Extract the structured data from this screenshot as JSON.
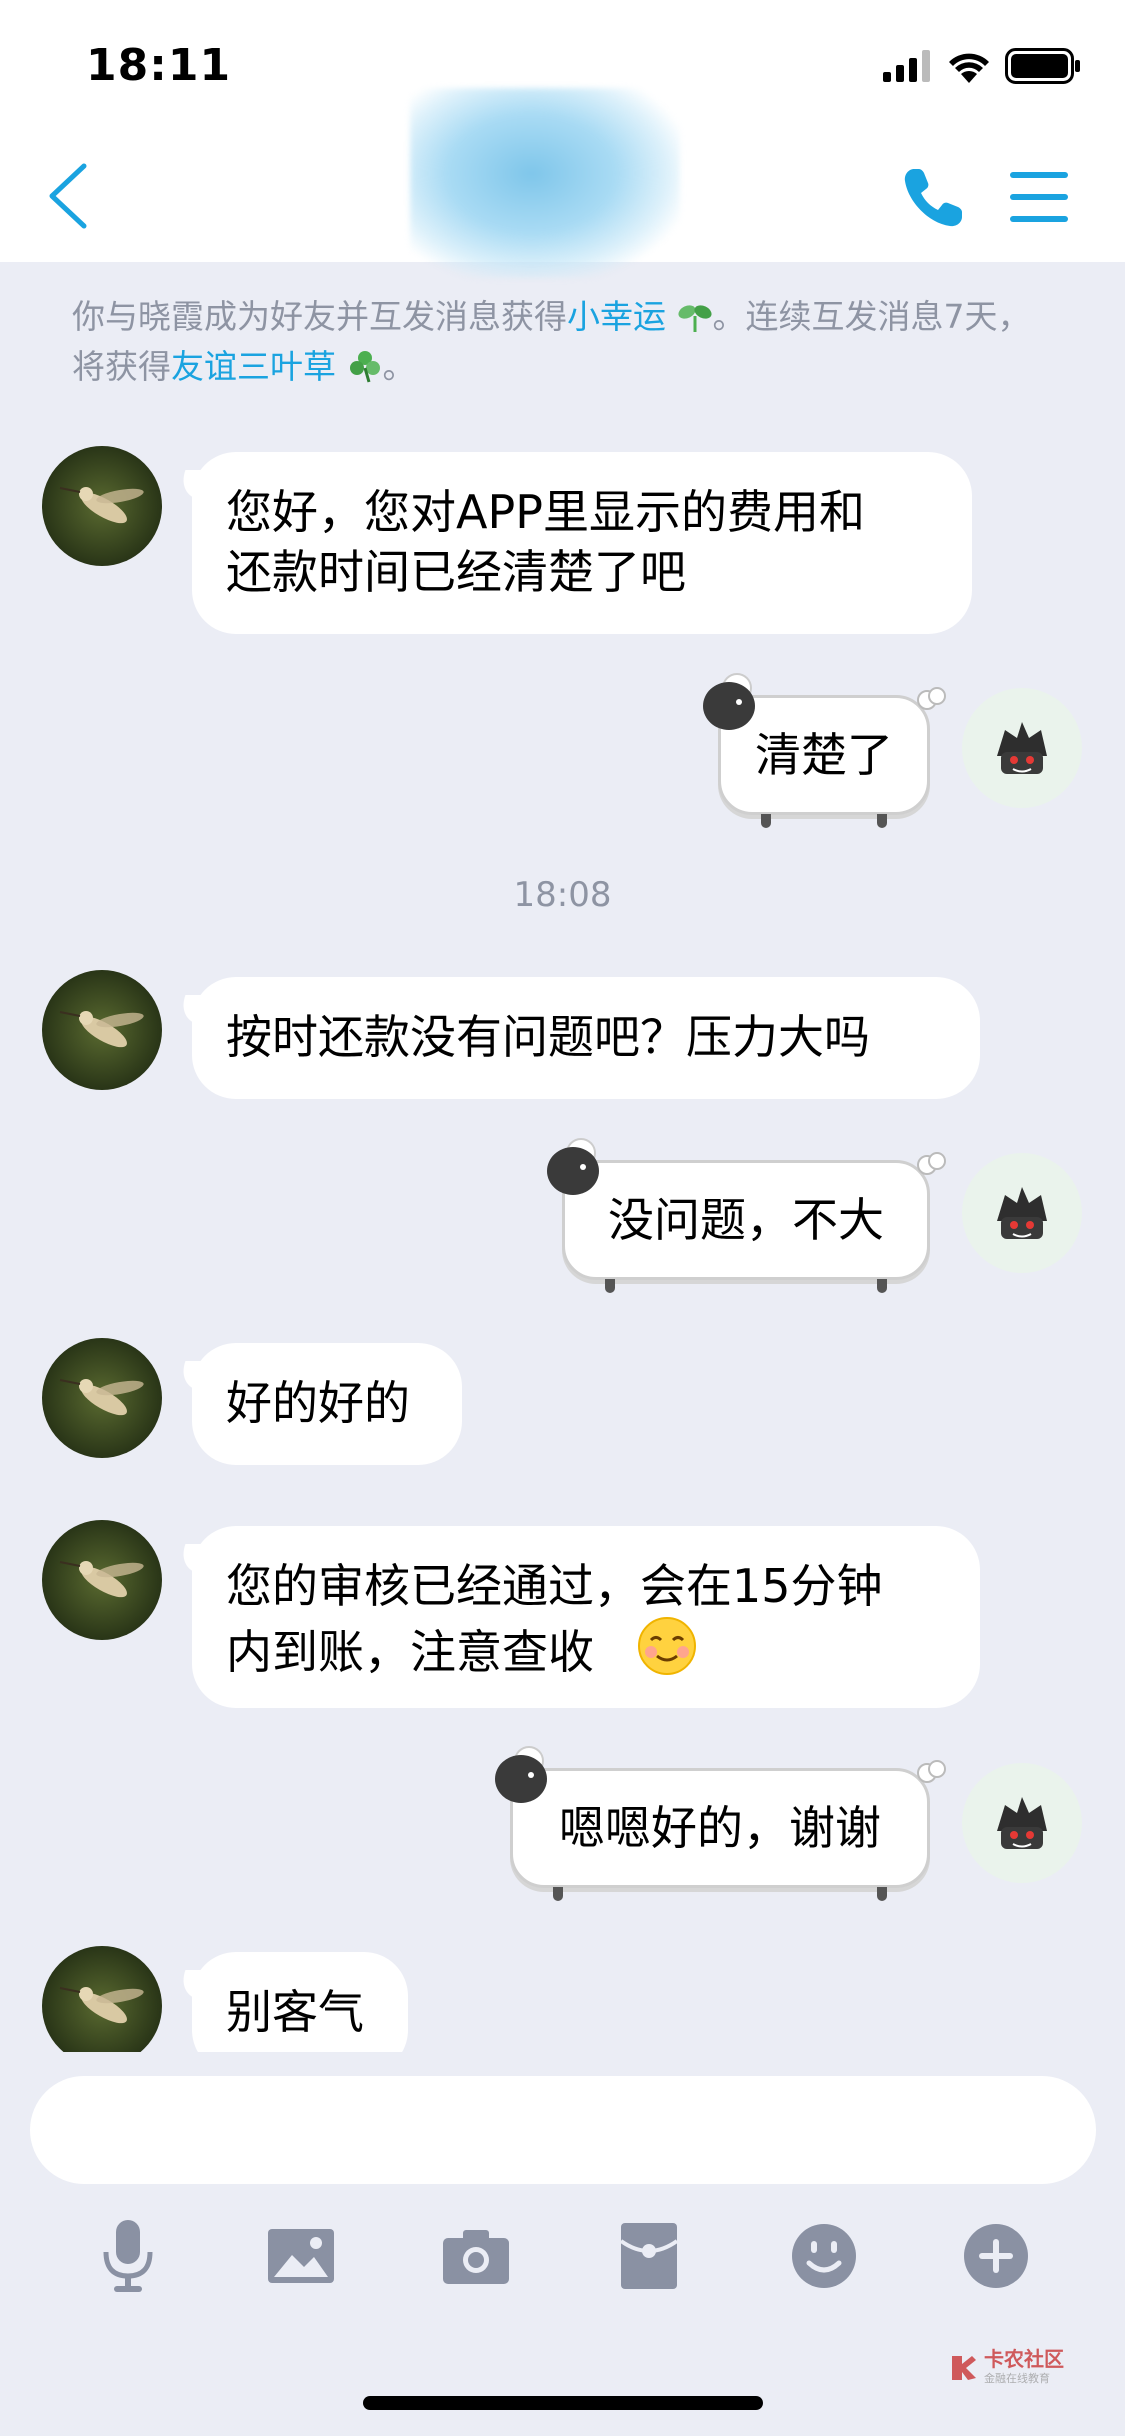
{
  "status_bar": {
    "time": "18:11"
  },
  "notice": {
    "part1": "你与晓霞成为好友并互发消息获得",
    "link1": "小幸运",
    "part2": "。连续互发消息7天，将获得",
    "link2": "友谊三叶草",
    "part3": "。"
  },
  "messages": [
    {
      "side": "in",
      "text_line1": "您好，您对APP里显示的费用和",
      "text_line2": "还款时间已经清楚了吧"
    },
    {
      "side": "out",
      "text": "清楚了"
    },
    {
      "side": "in",
      "text": "按时还款没有问题吧？压力大吗"
    },
    {
      "side": "out",
      "text": "没问题，不大"
    },
    {
      "side": "in",
      "text": "好的好的"
    },
    {
      "side": "in",
      "text_line1": "您的审核已经通过，会在15分钟",
      "text_line2": "内到账，注意查收",
      "emoji": "☺"
    },
    {
      "side": "out",
      "text": "嗯嗯好的，谢谢"
    },
    {
      "side": "in",
      "text": "别客气"
    }
  ],
  "timestamp": "18:08",
  "toolbar": [
    "microphone-icon",
    "image-icon",
    "camera-icon",
    "red-packet-icon",
    "emoji-icon",
    "plus-icon"
  ],
  "watermark": {
    "brand": "卡农社区",
    "sub": "金融在线教育"
  },
  "colors": {
    "accent": "#1aa3e0",
    "background": "#ebedf5",
    "icon_gray": "#8a91a3"
  }
}
